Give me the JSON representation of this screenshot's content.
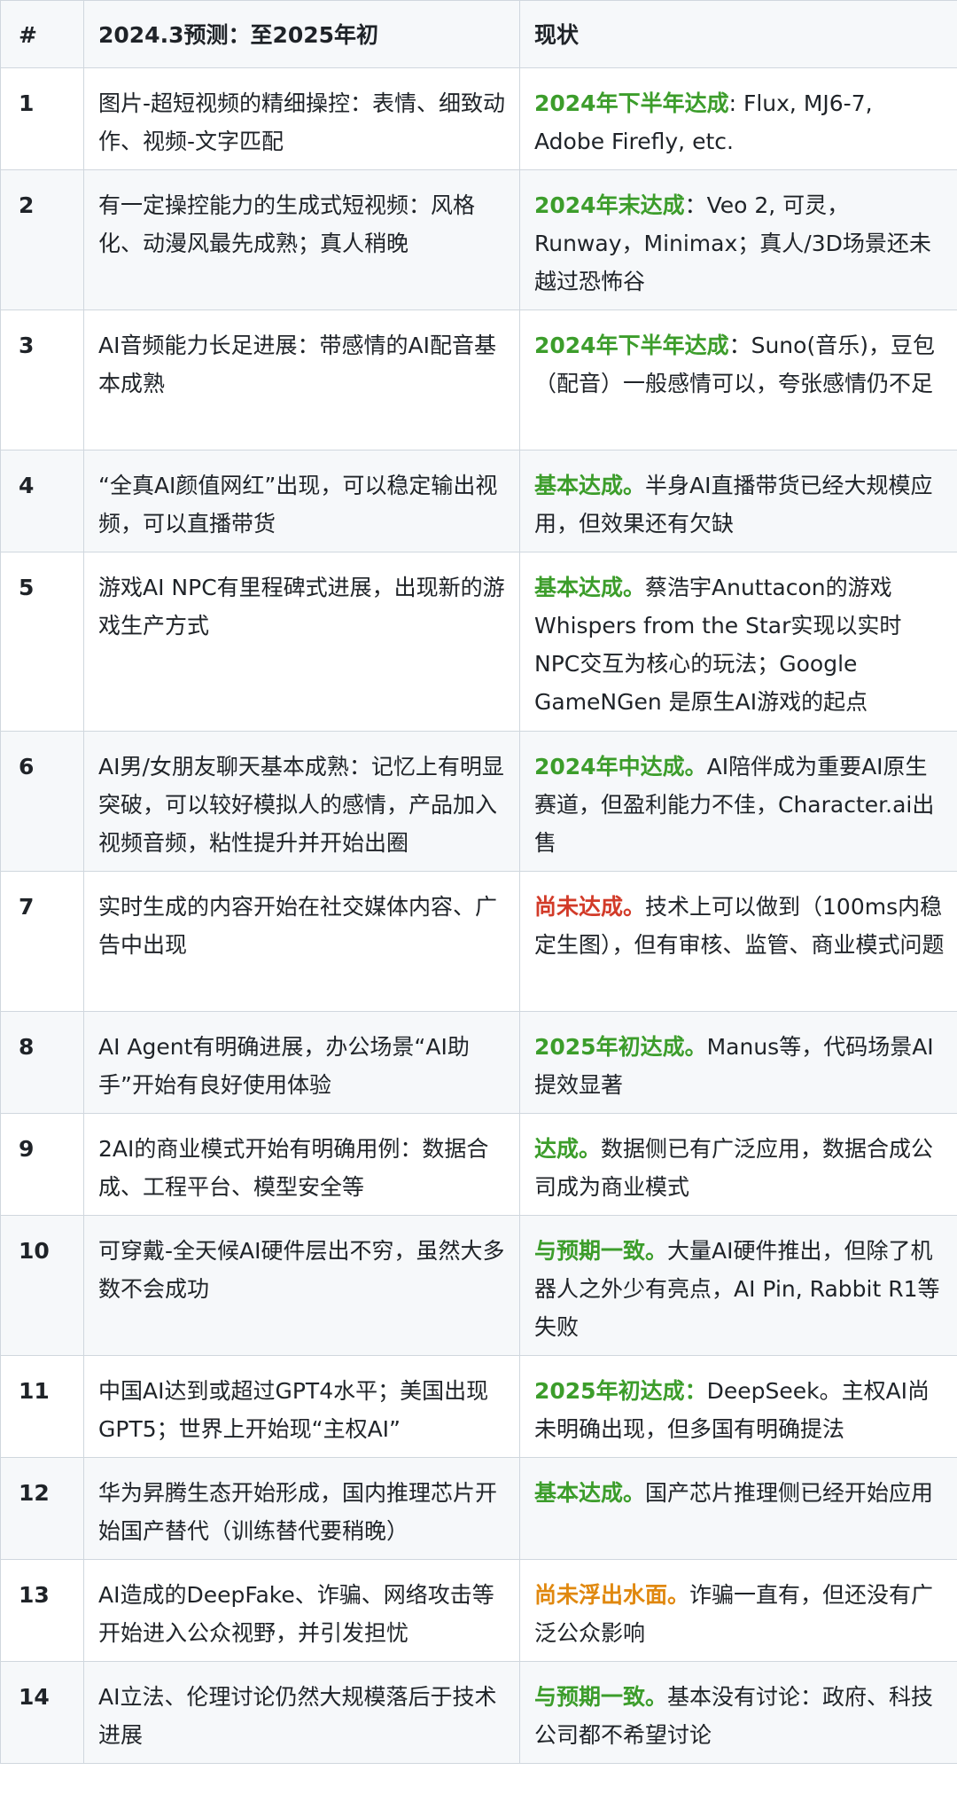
{
  "headers": {
    "num": "#",
    "prediction": "2024.3预测：至2025年初",
    "status": "现状"
  },
  "colors": {
    "achieved": "#3c9d2b",
    "not_achieved": "#d23b29",
    "not_surfaced": "#e0880f"
  },
  "rows": [
    {
      "num": "1",
      "prediction": "图片-超短视频的精细操控：表情、细致动作、视频-文字匹配",
      "status_tag": "2024年下半年达成",
      "status_text": ": Flux, MJ6-7, Adobe Firefly, etc."
    },
    {
      "num": "2",
      "prediction": "有一定操控能力的生成式短视频：风格化、动漫风最先成熟；真人稍晚",
      "status_tag": "2024年末达成",
      "status_text": "：Veo 2, 可灵，Runway，Minimax；真人/3D场景还未越过恐怖谷"
    },
    {
      "num": "3",
      "prediction": "AI音频能力长足进展：带感情的AI配音基本成熟",
      "status_tag": "2024年下半年达成",
      "status_text": "：Suno(音乐)，豆包（配音）一般感情可以，夸张感情仍不足"
    },
    {
      "num": "4",
      "prediction": "“全真AI颜值网红”出现，可以稳定输出视频，可以直播带货",
      "status_tag": "基本达成。",
      "status_text": "半身AI直播带货已经大规模应用，但效果还有欠缺"
    },
    {
      "num": "5",
      "prediction": "游戏AI NPC有里程碑式进展，出现新的游戏生产方式",
      "status_tag": "基本达成。",
      "status_text": "蔡浩宇Anuttacon的游戏Whispers from the Star实现以实时NPC交互为核心的玩法；Google GameNGen 是原生AI游戏的起点"
    },
    {
      "num": "6",
      "prediction": "AI男/女朋友聊天基本成熟：记忆上有明显突破，可以较好模拟人的感情，产品加入视频音频，粘性提升并开始出圈",
      "status_tag": "2024年中达成。",
      "status_text": "AI陪伴成为重要AI原生赛道，但盈利能力不佳，Character.ai出售"
    },
    {
      "num": "7",
      "prediction": "实时生成的内容开始在社交媒体内容、广告中出现",
      "status_tag": "尚未达成。",
      "status_text": "技术上可以做到（100ms内稳定生图），但有审核、监管、商业模式问题"
    },
    {
      "num": "8",
      "prediction": "AI Agent有明确进展，办公场景“AI助手”开始有良好使用体验",
      "status_tag": "2025年初达成。",
      "status_text": "Manus等，代码场景AI提效显著"
    },
    {
      "num": "9",
      "prediction": "2AI的商业模式开始有明确用例：数据合成、工程平台、模型安全等",
      "status_tag": "达成。",
      "status_text": "数据侧已有广泛应用，数据合成公司成为商业模式"
    },
    {
      "num": "10",
      "prediction": "可穿戴-全天候AI硬件层出不穷，虽然大多数不会成功",
      "status_tag": "与预期一致。",
      "status_text": "大量AI硬件推出，但除了机器人之外少有亮点，AI Pin, Rabbit R1等失败"
    },
    {
      "num": "11",
      "prediction": "中国AI达到或超过GPT4水平；美国出现GPT5；世界上开始现“主权AI”",
      "status_tag": "2025年初达成：",
      "status_text": "DeepSeek。主权AI尚未明确出现，但多国有明确提法"
    },
    {
      "num": "12",
      "prediction": "华为昇腾生态开始形成，国内推理芯片开始国产替代（训练替代要稍晚）",
      "status_tag": "基本达成。",
      "status_text": "国产芯片推理侧已经开始应用"
    },
    {
      "num": "13",
      "prediction": "AI造成的DeepFake、诈骗、网络攻击等开始进入公众视野，并引发担忧",
      "status_tag": "尚未浮出水面。",
      "status_text": "诈骗一直有，但还没有广泛公众影响"
    },
    {
      "num": "14",
      "prediction": "AI立法、伦理讨论仍然大规模落后于技术进展",
      "status_tag": "与预期一致。",
      "status_text": "基本没有讨论：政府、科技公司都不希望讨论"
    }
  ]
}
